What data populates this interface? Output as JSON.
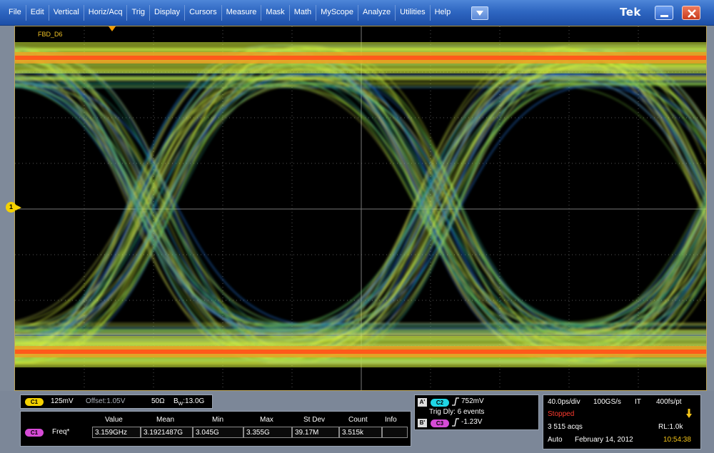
{
  "menu": {
    "items": [
      "File",
      "Edit",
      "Vertical",
      "Horiz/Acq",
      "Trig",
      "Display",
      "Cursors",
      "Measure",
      "Mask",
      "Math",
      "MyScope",
      "Analyze",
      "Utilities",
      "Help"
    ],
    "logo": "Tek"
  },
  "display": {
    "channel_label": "FBD_D6",
    "ch1_marker": "1"
  },
  "channel_readout": {
    "badge": "C1",
    "scale": "125mV",
    "offset": "Offset:1.05V",
    "impedance": "50Ω",
    "bandwidth_label": "B",
    "bandwidth_sub": "W",
    "bandwidth_value": ":13.0G"
  },
  "measurement": {
    "headers": [
      "Value",
      "Mean",
      "Min",
      "Max",
      "St Dev",
      "Count",
      "Info"
    ],
    "row": {
      "badge": "C1",
      "label": "Freq*",
      "values": [
        "3.159GHz",
        "3.1921487G",
        "3.045G",
        "3.355G",
        "39.17M",
        "3.515k",
        ""
      ]
    }
  },
  "trigger": {
    "a_label": "A'",
    "a_badge": "C2",
    "a_level": "752mV",
    "delay": "Trig Dly: 6 events",
    "b_label": "B'",
    "b_badge": "C3",
    "b_level": "-1.23V"
  },
  "acquisition": {
    "timebase": "40.0ps/div",
    "sample_rate": "100GS/s",
    "mode": "IT",
    "resolution": "400fs/pt",
    "status": "Stopped",
    "acqs": "3 515 acqs",
    "record_length": "RL:1.0k",
    "trigger_mode": "Auto",
    "date": "February 14, 2012",
    "time": "10:54:38"
  },
  "colors": {
    "menubar": "#2f67c2",
    "eye_core": "#d7f23a",
    "eye_hot": "#ff5a1a",
    "eye_edge": "#1e6fd0",
    "stopped": "#ff3b2f",
    "time": "#f5c518",
    "badge_c1": "#f4d100",
    "badge_c2": "#1fd6e6",
    "badge_c3": "#d64bd6"
  }
}
